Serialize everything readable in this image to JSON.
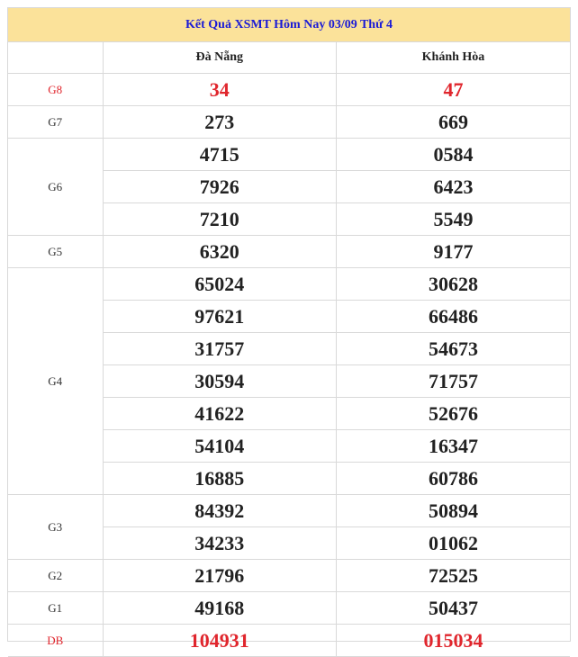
{
  "title": "Kết Quả XSMT Hôm Nay 03/09 Thứ 4",
  "columns": [
    "Đà Nẵng",
    "Khánh Hòa"
  ],
  "prizes": [
    {
      "label": "G8",
      "highlight": true,
      "rows": [
        [
          "34",
          "47"
        ]
      ]
    },
    {
      "label": "G7",
      "highlight": false,
      "rows": [
        [
          "273",
          "669"
        ]
      ]
    },
    {
      "label": "G6",
      "highlight": false,
      "rows": [
        [
          "4715",
          "0584"
        ],
        [
          "7926",
          "6423"
        ],
        [
          "7210",
          "5549"
        ]
      ]
    },
    {
      "label": "G5",
      "highlight": false,
      "rows": [
        [
          "6320",
          "9177"
        ]
      ]
    },
    {
      "label": "G4",
      "highlight": false,
      "rows": [
        [
          "65024",
          "30628"
        ],
        [
          "97621",
          "66486"
        ],
        [
          "31757",
          "54673"
        ],
        [
          "30594",
          "71757"
        ],
        [
          "41622",
          "52676"
        ],
        [
          "54104",
          "16347"
        ],
        [
          "16885",
          "60786"
        ]
      ]
    },
    {
      "label": "G3",
      "highlight": false,
      "rows": [
        [
          "84392",
          "50894"
        ],
        [
          "34233",
          "01062"
        ]
      ]
    },
    {
      "label": "G2",
      "highlight": false,
      "rows": [
        [
          "21796",
          "72525"
        ]
      ]
    },
    {
      "label": "G1",
      "highlight": false,
      "rows": [
        [
          "49168",
          "50437"
        ]
      ]
    },
    {
      "label": "DB",
      "highlight": true,
      "rows": [
        [
          "104931",
          "015034"
        ]
      ]
    }
  ],
  "colors": {
    "title_bg": "#fbe29a",
    "title_text": "#1b1bd6",
    "highlight": "#e0262d",
    "border": "#d9d9d9"
  }
}
